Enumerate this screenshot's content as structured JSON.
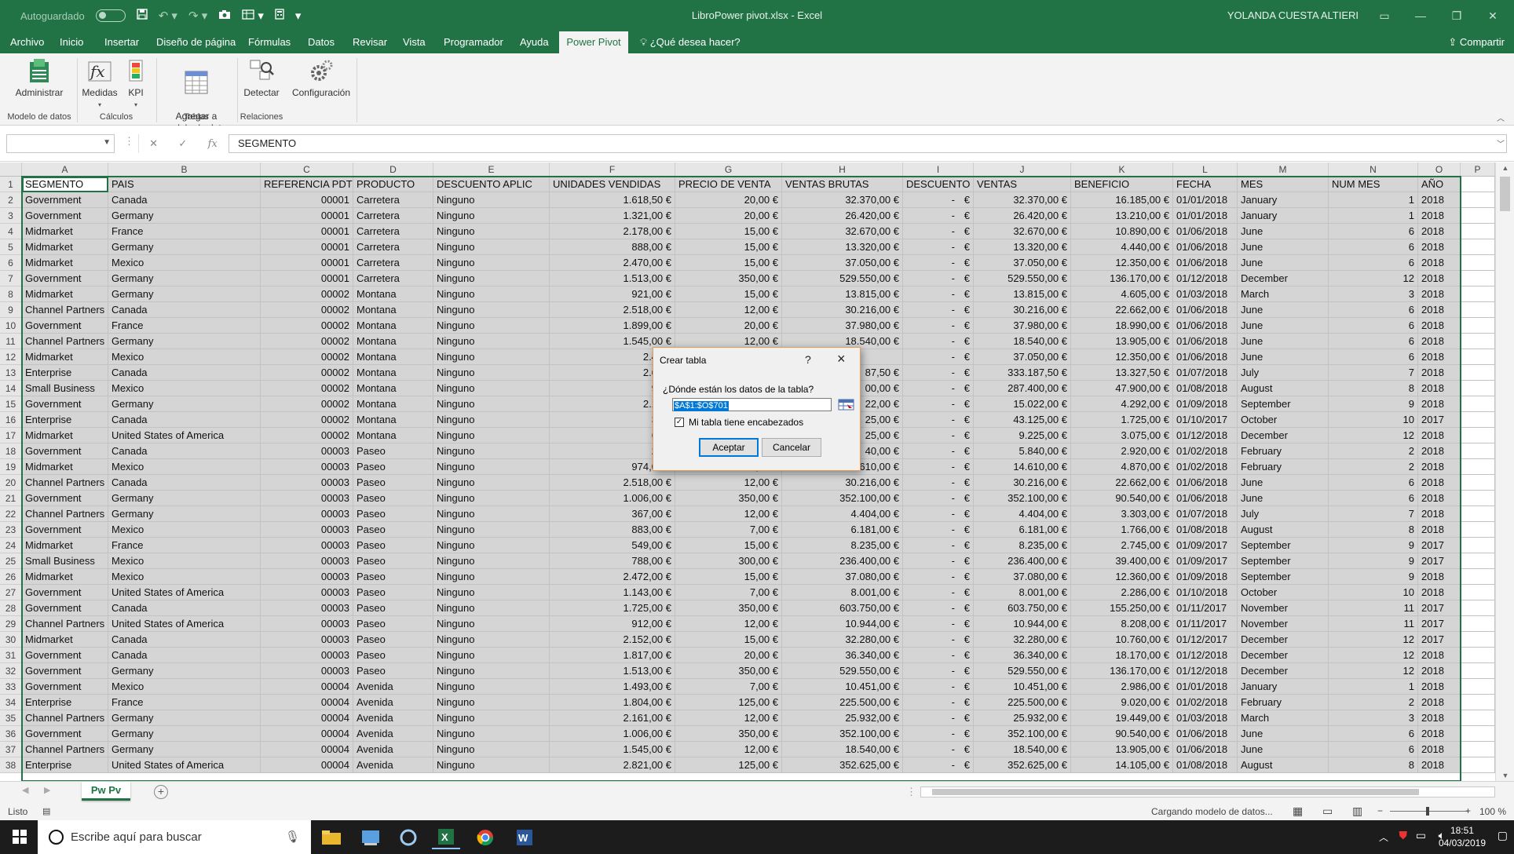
{
  "titlebar": {
    "autosave_label": "Autoguardado",
    "doc_title": "LibroPower pivot.xlsx  -  Excel",
    "user": "YOLANDA CUESTA ALTIERI"
  },
  "menu": {
    "tabs": [
      "Archivo",
      "Inicio",
      "Insertar",
      "Diseño de página",
      "Fórmulas",
      "Datos",
      "Revisar",
      "Vista",
      "Programador",
      "Ayuda",
      "Power Pivot"
    ],
    "active": "Power Pivot",
    "tell_me": "¿Qué desea hacer?",
    "share": "Compartir"
  },
  "ribbon": {
    "buttons": [
      {
        "label": "Administrar",
        "icon": "manage-data-model-icon"
      },
      {
        "label": "Medidas",
        "icon": "measures-fx-icon"
      },
      {
        "label": "KPI",
        "icon": "kpi-icon"
      },
      {
        "label": "Agregar a\nmodelo de datos",
        "icon": "add-to-data-model-icon"
      },
      {
        "label": "Detectar",
        "icon": "detect-relationships-icon"
      },
      {
        "label": "Configuración",
        "icon": "gear-icon"
      }
    ],
    "groups": [
      "Modelo de datos",
      "Cálculos",
      "Tablas",
      "Relaciones"
    ]
  },
  "formula_bar": {
    "name_box": "",
    "content": "SEGMENTO"
  },
  "sheet": {
    "col_letters": [
      "A",
      "B",
      "C",
      "D",
      "E",
      "F",
      "G",
      "H",
      "I",
      "J",
      "K",
      "L",
      "M",
      "N",
      "O",
      "P"
    ],
    "headers": [
      "SEGMENTO",
      "PAIS",
      "REFERENCIA PDTO",
      "PRODUCTO",
      "DESCUENTO APLIC",
      "UNIDADES VENDIDAS",
      "PRECIO DE VENTA",
      "VENTAS BRUTAS",
      "DESCUENTO",
      "VENTAS",
      "BENEFICIO",
      "FECHA",
      "MES",
      "NUM MES",
      "AÑO"
    ],
    "rows": [
      [
        "Government",
        "Canada",
        "00001",
        "Carretera",
        "Ninguno",
        "1.618,50 €",
        "20,00 €",
        "32.370,00 €",
        "-",
        "€",
        "32.370,00 €",
        "16.185,00 €",
        "01/01/2018",
        "January",
        "1",
        "2018"
      ],
      [
        "Government",
        "Germany",
        "00001",
        "Carretera",
        "Ninguno",
        "1.321,00 €",
        "20,00 €",
        "26.420,00 €",
        "-",
        "€",
        "26.420,00 €",
        "13.210,00 €",
        "01/01/2018",
        "January",
        "1",
        "2018"
      ],
      [
        "Midmarket",
        "France",
        "00001",
        "Carretera",
        "Ninguno",
        "2.178,00 €",
        "15,00 €",
        "32.670,00 €",
        "-",
        "€",
        "32.670,00 €",
        "10.890,00 €",
        "01/06/2018",
        "June",
        "6",
        "2018"
      ],
      [
        "Midmarket",
        "Germany",
        "00001",
        "Carretera",
        "Ninguno",
        "888,00 €",
        "15,00 €",
        "13.320,00 €",
        "-",
        "€",
        "13.320,00 €",
        "4.440,00 €",
        "01/06/2018",
        "June",
        "6",
        "2018"
      ],
      [
        "Midmarket",
        "Mexico",
        "00001",
        "Carretera",
        "Ninguno",
        "2.470,00 €",
        "15,00 €",
        "37.050,00 €",
        "-",
        "€",
        "37.050,00 €",
        "12.350,00 €",
        "01/06/2018",
        "June",
        "6",
        "2018"
      ],
      [
        "Government",
        "Germany",
        "00001",
        "Carretera",
        "Ninguno",
        "1.513,00 €",
        "350,00 €",
        "529.550,00 €",
        "-",
        "€",
        "529.550,00 €",
        "136.170,00 €",
        "01/12/2018",
        "December",
        "12",
        "2018"
      ],
      [
        "Midmarket",
        "Germany",
        "00002",
        "Montana",
        "Ninguno",
        "921,00 €",
        "15,00 €",
        "13.815,00 €",
        "-",
        "€",
        "13.815,00 €",
        "4.605,00 €",
        "01/03/2018",
        "March",
        "3",
        "2018"
      ],
      [
        "Channel Partners",
        "Canada",
        "00002",
        "Montana",
        "Ninguno",
        "2.518,00 €",
        "12,00 €",
        "30.216,00 €",
        "-",
        "€",
        "30.216,00 €",
        "22.662,00 €",
        "01/06/2018",
        "June",
        "6",
        "2018"
      ],
      [
        "Government",
        "France",
        "00002",
        "Montana",
        "Ninguno",
        "1.899,00 €",
        "20,00 €",
        "37.980,00 €",
        "-",
        "€",
        "37.980,00 €",
        "18.990,00 €",
        "01/06/2018",
        "June",
        "6",
        "2018"
      ],
      [
        "Channel Partners",
        "Germany",
        "00002",
        "Montana",
        "Ninguno",
        "1.545,00 €",
        "12,00 €",
        "18.540,00 €",
        "-",
        "€",
        "18.540,00 €",
        "13.905,00 €",
        "01/06/2018",
        "June",
        "6",
        "2018"
      ],
      [
        "Midmarket",
        "Mexico",
        "00002",
        "Montana",
        "Ninguno",
        "2.470,",
        "",
        "",
        "-",
        "€",
        "37.050,00 €",
        "12.350,00 €",
        "01/06/2018",
        "June",
        "6",
        "2018"
      ],
      [
        "Enterprise",
        "Canada",
        "00002",
        "Montana",
        "Ninguno",
        "2.665,",
        "",
        "87,50 €",
        "-",
        "€",
        "333.187,50 €",
        "13.327,50 €",
        "01/07/2018",
        "July",
        "7",
        "2018"
      ],
      [
        "Small Business",
        "Mexico",
        "00002",
        "Montana",
        "Ninguno",
        "958,",
        "",
        "00,00 €",
        "-",
        "€",
        "287.400,00 €",
        "47.900,00 €",
        "01/08/2018",
        "August",
        "8",
        "2018"
      ],
      [
        "Government",
        "Germany",
        "00002",
        "Montana",
        "Ninguno",
        "2.146,",
        "",
        "22,00 €",
        "-",
        "€",
        "15.022,00 €",
        "4.292,00 €",
        "01/09/2018",
        "September",
        "9",
        "2018"
      ],
      [
        "Enterprise",
        "Canada",
        "00002",
        "Montana",
        "Ninguno",
        "345,",
        "",
        "25,00 €",
        "-",
        "€",
        "43.125,00 €",
        "1.725,00 €",
        "01/10/2017",
        "October",
        "10",
        "2017"
      ],
      [
        "Midmarket",
        "United States of America",
        "00002",
        "Montana",
        "Ninguno",
        "615,",
        "",
        "25,00 €",
        "-",
        "€",
        "9.225,00 €",
        "3.075,00 €",
        "01/12/2018",
        "December",
        "12",
        "2018"
      ],
      [
        "Government",
        "Canada",
        "00003",
        "Paseo",
        "Ninguno",
        "292,",
        "",
        "40,00 €",
        "-",
        "€",
        "5.840,00 €",
        "2.920,00 €",
        "01/02/2018",
        "February",
        "2",
        "2018"
      ],
      [
        "Midmarket",
        "Mexico",
        "00003",
        "Paseo",
        "Ninguno",
        "974,00 €",
        "15,00 €",
        "14.610,00 €",
        "-",
        "€",
        "14.610,00 €",
        "4.870,00 €",
        "01/02/2018",
        "February",
        "2",
        "2018"
      ],
      [
        "Channel Partners",
        "Canada",
        "00003",
        "Paseo",
        "Ninguno",
        "2.518,00 €",
        "12,00 €",
        "30.216,00 €",
        "-",
        "€",
        "30.216,00 €",
        "22.662,00 €",
        "01/06/2018",
        "June",
        "6",
        "2018"
      ],
      [
        "Government",
        "Germany",
        "00003",
        "Paseo",
        "Ninguno",
        "1.006,00 €",
        "350,00 €",
        "352.100,00 €",
        "-",
        "€",
        "352.100,00 €",
        "90.540,00 €",
        "01/06/2018",
        "June",
        "6",
        "2018"
      ],
      [
        "Channel Partners",
        "Germany",
        "00003",
        "Paseo",
        "Ninguno",
        "367,00 €",
        "12,00 €",
        "4.404,00 €",
        "-",
        "€",
        "4.404,00 €",
        "3.303,00 €",
        "01/07/2018",
        "July",
        "7",
        "2018"
      ],
      [
        "Government",
        "Mexico",
        "00003",
        "Paseo",
        "Ninguno",
        "883,00 €",
        "7,00 €",
        "6.181,00 €",
        "-",
        "€",
        "6.181,00 €",
        "1.766,00 €",
        "01/08/2018",
        "August",
        "8",
        "2018"
      ],
      [
        "Midmarket",
        "France",
        "00003",
        "Paseo",
        "Ninguno",
        "549,00 €",
        "15,00 €",
        "8.235,00 €",
        "-",
        "€",
        "8.235,00 €",
        "2.745,00 €",
        "01/09/2017",
        "September",
        "9",
        "2017"
      ],
      [
        "Small Business",
        "Mexico",
        "00003",
        "Paseo",
        "Ninguno",
        "788,00 €",
        "300,00 €",
        "236.400,00 €",
        "-",
        "€",
        "236.400,00 €",
        "39.400,00 €",
        "01/09/2017",
        "September",
        "9",
        "2017"
      ],
      [
        "Midmarket",
        "Mexico",
        "00003",
        "Paseo",
        "Ninguno",
        "2.472,00 €",
        "15,00 €",
        "37.080,00 €",
        "-",
        "€",
        "37.080,00 €",
        "12.360,00 €",
        "01/09/2018",
        "September",
        "9",
        "2018"
      ],
      [
        "Government",
        "United States of America",
        "00003",
        "Paseo",
        "Ninguno",
        "1.143,00 €",
        "7,00 €",
        "8.001,00 €",
        "-",
        "€",
        "8.001,00 €",
        "2.286,00 €",
        "01/10/2018",
        "October",
        "10",
        "2018"
      ],
      [
        "Government",
        "Canada",
        "00003",
        "Paseo",
        "Ninguno",
        "1.725,00 €",
        "350,00 €",
        "603.750,00 €",
        "-",
        "€",
        "603.750,00 €",
        "155.250,00 €",
        "01/11/2017",
        "November",
        "11",
        "2017"
      ],
      [
        "Channel Partners",
        "United States of America",
        "00003",
        "Paseo",
        "Ninguno",
        "912,00 €",
        "12,00 €",
        "10.944,00 €",
        "-",
        "€",
        "10.944,00 €",
        "8.208,00 €",
        "01/11/2017",
        "November",
        "11",
        "2017"
      ],
      [
        "Midmarket",
        "Canada",
        "00003",
        "Paseo",
        "Ninguno",
        "2.152,00 €",
        "15,00 €",
        "32.280,00 €",
        "-",
        "€",
        "32.280,00 €",
        "10.760,00 €",
        "01/12/2017",
        "December",
        "12",
        "2017"
      ],
      [
        "Government",
        "Canada",
        "00003",
        "Paseo",
        "Ninguno",
        "1.817,00 €",
        "20,00 €",
        "36.340,00 €",
        "-",
        "€",
        "36.340,00 €",
        "18.170,00 €",
        "01/12/2018",
        "December",
        "12",
        "2018"
      ],
      [
        "Government",
        "Germany",
        "00003",
        "Paseo",
        "Ninguno",
        "1.513,00 €",
        "350,00 €",
        "529.550,00 €",
        "-",
        "€",
        "529.550,00 €",
        "136.170,00 €",
        "01/12/2018",
        "December",
        "12",
        "2018"
      ],
      [
        "Government",
        "Mexico",
        "00004",
        "Avenida",
        "Ninguno",
        "1.493,00 €",
        "7,00 €",
        "10.451,00 €",
        "-",
        "€",
        "10.451,00 €",
        "2.986,00 €",
        "01/01/2018",
        "January",
        "1",
        "2018"
      ],
      [
        "Enterprise",
        "France",
        "00004",
        "Avenida",
        "Ninguno",
        "1.804,00 €",
        "125,00 €",
        "225.500,00 €",
        "-",
        "€",
        "225.500,00 €",
        "9.020,00 €",
        "01/02/2018",
        "February",
        "2",
        "2018"
      ],
      [
        "Channel Partners",
        "Germany",
        "00004",
        "Avenida",
        "Ninguno",
        "2.161,00 €",
        "12,00 €",
        "25.932,00 €",
        "-",
        "€",
        "25.932,00 €",
        "19.449,00 €",
        "01/03/2018",
        "March",
        "3",
        "2018"
      ],
      [
        "Government",
        "Germany",
        "00004",
        "Avenida",
        "Ninguno",
        "1.006,00 €",
        "350,00 €",
        "352.100,00 €",
        "-",
        "€",
        "352.100,00 €",
        "90.540,00 €",
        "01/06/2018",
        "June",
        "6",
        "2018"
      ],
      [
        "Channel Partners",
        "Germany",
        "00004",
        "Avenida",
        "Ninguno",
        "1.545,00 €",
        "12,00 €",
        "18.540,00 €",
        "-",
        "€",
        "18.540,00 €",
        "13.905,00 €",
        "01/06/2018",
        "June",
        "6",
        "2018"
      ],
      [
        "Enterprise",
        "United States of America",
        "00004",
        "Avenida",
        "Ninguno",
        "2.821,00 €",
        "125,00 €",
        "352.625,00 €",
        "-",
        "€",
        "352.625,00 €",
        "14.105,00 €",
        "01/08/2018",
        "August",
        "8",
        "2018"
      ]
    ]
  },
  "sheet_tabs": {
    "active": "Pw Pv"
  },
  "status": {
    "left": "Listo",
    "loading": "Cargando modelo de datos...",
    "zoom": "100 %"
  },
  "taskbar": {
    "search_placeholder": "Escribe aquí para buscar",
    "time": "18:51",
    "date": "04/03/2019"
  },
  "dialog": {
    "title": "Crear tabla",
    "help": "?",
    "prompt": "¿Dónde están los datos de la tabla?",
    "range": "$A$1:$O$701",
    "checkbox_label": "Mi tabla tiene encabezados",
    "checkbox_checked": true,
    "ok": "Aceptar",
    "cancel": "Cancelar"
  },
  "colors": {
    "excel_green": "#217346",
    "selection_gray": "#d5d5d5",
    "dialog_border": "#e79a52"
  }
}
